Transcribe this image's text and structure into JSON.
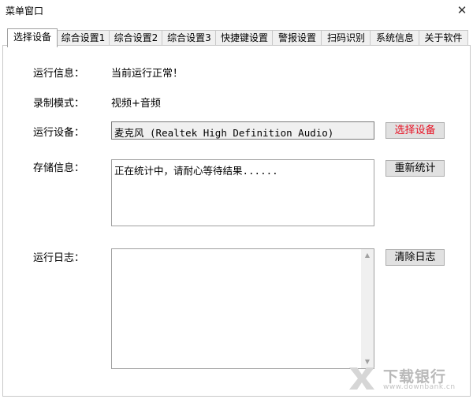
{
  "window": {
    "title": "菜单窗口"
  },
  "tabs": [
    "选择设备",
    "综合设置1",
    "综合设置2",
    "综合设置3",
    "快捷键设置",
    "警报设置",
    "扫码识别",
    "系统信息",
    "关于软件"
  ],
  "form": {
    "run_info_label": "运行信息：",
    "run_info_value": "当前运行正常！",
    "record_mode_label": "录制模式：",
    "record_mode_value": "视频+音频",
    "device_label": "运行设备：",
    "device_value": "麦克风 (Realtek High Definition Audio)",
    "select_device_button": "选择设备",
    "storage_label": "存储信息：",
    "storage_text": "正在统计中，请耐心等待结果......",
    "recount_button": "重新统计",
    "log_label": "运行日志：",
    "log_text": "",
    "clear_log_button": "清除日志"
  },
  "colors": {
    "select_device_text": "#e81123"
  },
  "watermark": {
    "text": "下载银行",
    "sub": "www.downbank.cn"
  }
}
